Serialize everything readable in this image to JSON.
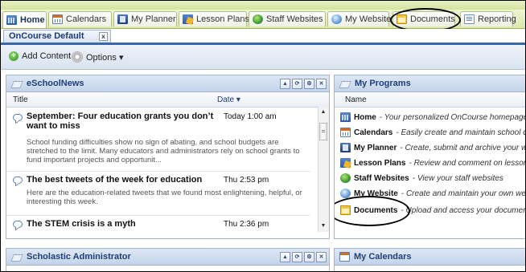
{
  "tabs": [
    {
      "label": "Home",
      "icon": "home-icon"
    },
    {
      "label": "Calendars",
      "icon": "calendar-icon"
    },
    {
      "label": "My Planner",
      "icon": "planner-icon"
    },
    {
      "label": "Lesson Plans",
      "icon": "lesson-plans-icon"
    },
    {
      "label": "Staff Websites",
      "icon": "globe-icon"
    },
    {
      "label": "My Website",
      "icon": "website-icon"
    },
    {
      "label": "Documents",
      "icon": "documents-icon"
    },
    {
      "label": "Reporting",
      "icon": "report-icon"
    }
  ],
  "subtab": {
    "label": "OnCourse Default",
    "close": "x"
  },
  "toolbar": {
    "add_content": "Add Content",
    "options": "Options ▾"
  },
  "news": {
    "title": "eSchoolNews",
    "col_title": "Title",
    "col_date": "Date ▾",
    "items": [
      {
        "title": "September: Four education grants you don’t want to miss",
        "date": "Today 1:00 am",
        "desc": "School funding difficulties show no sign of abating, and school budgets are stretched to the limit. Many educators and administrators rely on school grants to fund important projects and opportunit..."
      },
      {
        "title": "The best tweets of the week for education",
        "date": "Thu 2:53 pm",
        "desc": "Here are the education-related tweets that we found most enlightening, helpful, or interesting this week."
      },
      {
        "title": "The STEM crisis is a myth",
        "date": "Thu 2:36 pm",
        "desc": ""
      }
    ]
  },
  "programs": {
    "title": "My Programs",
    "col_name": "Name",
    "items": [
      {
        "name": "Home",
        "desc": " - Your personalized OnCourse homepage"
      },
      {
        "name": "Calendars",
        "desc": " - Easily create and maintain school c"
      },
      {
        "name": "My Planner",
        "desc": " - Create, submit and archive your w"
      },
      {
        "name": "Lesson Plans",
        "desc": " - Review and comment on lesson"
      },
      {
        "name": "Staff Websites",
        "desc": " - View your staff websites"
      },
      {
        "name": "My Website",
        "desc": " - Create and maintain your own web"
      },
      {
        "name": "Documents",
        "desc": " - Upload and access your documen"
      }
    ]
  },
  "scholastic": {
    "title": "Scholastic Administrator"
  },
  "calendars_panel": {
    "title": "My Calendars"
  },
  "colors": {
    "accent": "#3a67a8",
    "header_text": "#1f3f78",
    "tab_bg": "#dbe8ad"
  }
}
